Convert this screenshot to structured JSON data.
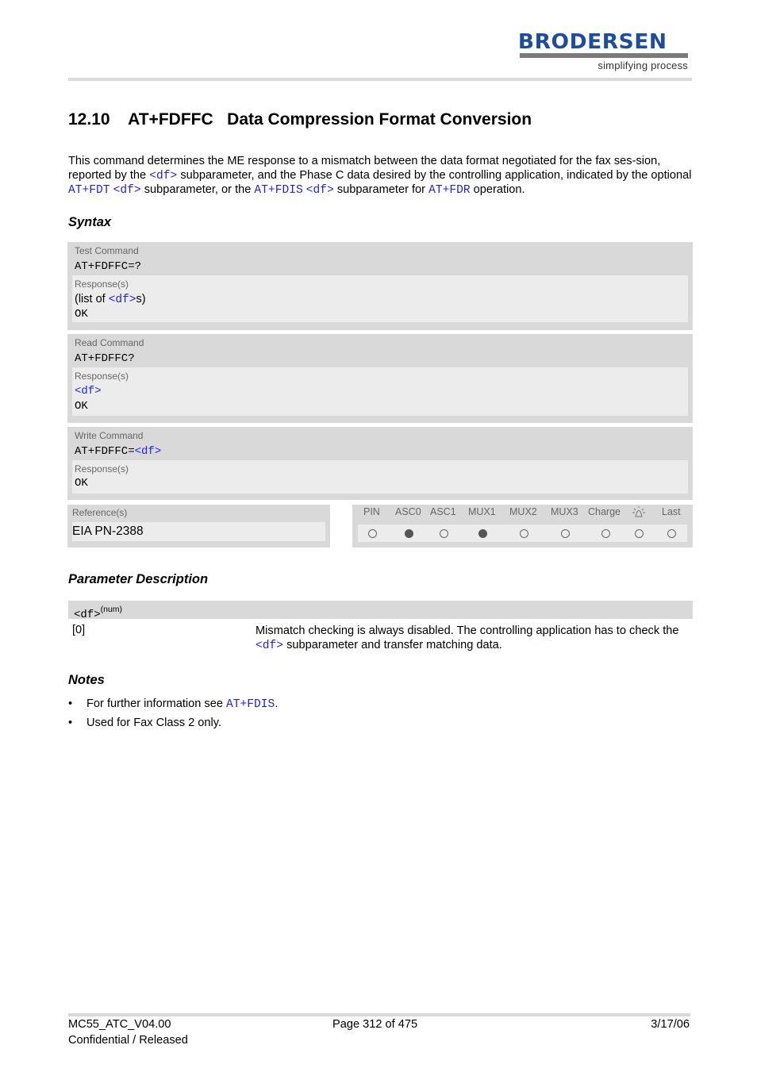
{
  "header": {
    "logo_brand": "BRODERSEN",
    "logo_tagline": "simplifying process"
  },
  "section": {
    "number": "12.10",
    "command": "AT+FDFFC",
    "title": "Data Compression Format Conversion"
  },
  "intro": {
    "t1": "This command determines the ME response to a mismatch between the data format negotiated for the fax ses-sion, reported by the ",
    "l1": "<df>",
    "t2": " subparameter, and the Phase C data desired by the controlling application, indicated by the optional ",
    "l2": "AT+FDT",
    "t3": " ",
    "l3": "<df>",
    "t4": " subparameter, or the ",
    "l4": "AT+FDIS",
    "t5": " ",
    "l5": "<df>",
    "t6": " subparameter for ",
    "l6": "AT+FDR",
    "t7": " operation."
  },
  "syntax": {
    "heading": "Syntax",
    "test": {
      "label": "Test Command",
      "command": "AT+FDFFC=?",
      "response_label": "Response(s)",
      "resp_pre": "(list of ",
      "resp_link": "<df>",
      "resp_post": "s)",
      "resp_ok": "OK"
    },
    "read": {
      "label": "Read Command",
      "command": "AT+FDFFC?",
      "response_label": "Response(s)",
      "resp_link": "<df>",
      "resp_ok": "OK"
    },
    "write": {
      "label": "Write Command",
      "command": "AT+FDFFC=",
      "command_link": "<df>",
      "response_label": "Response(s)",
      "resp_ok": "OK"
    },
    "reference": {
      "label": "Reference(s)",
      "value": "EIA PN-2388"
    },
    "pin_table": {
      "headers": [
        "PIN",
        "ASC0",
        "ASC1",
        "MUX1",
        "MUX2",
        "MUX3",
        "Charge",
        "alarm-clock-icon",
        "Last"
      ],
      "values": [
        false,
        true,
        false,
        true,
        false,
        false,
        false,
        false,
        false
      ]
    }
  },
  "parameters": {
    "heading": "Parameter Description",
    "name": "<df>",
    "type": "(num)",
    "items": [
      {
        "value": "[0]",
        "desc_pre": "Mismatch checking is always disabled. The controlling application has to check the ",
        "desc_link": "<df>",
        "desc_post": " subparameter and transfer matching data."
      }
    ]
  },
  "notes": {
    "heading": "Notes",
    "bullet": "•",
    "n1_pre": "For further information see ",
    "n1_link": "AT+FDIS",
    "n1_post": ".",
    "n2": "Used for Fax Class 2 only."
  },
  "footer": {
    "doc_id": "MC55_ATC_V04.00",
    "status": "Confidential / Released",
    "page": "Page 312 of 475",
    "date": "3/17/06"
  }
}
